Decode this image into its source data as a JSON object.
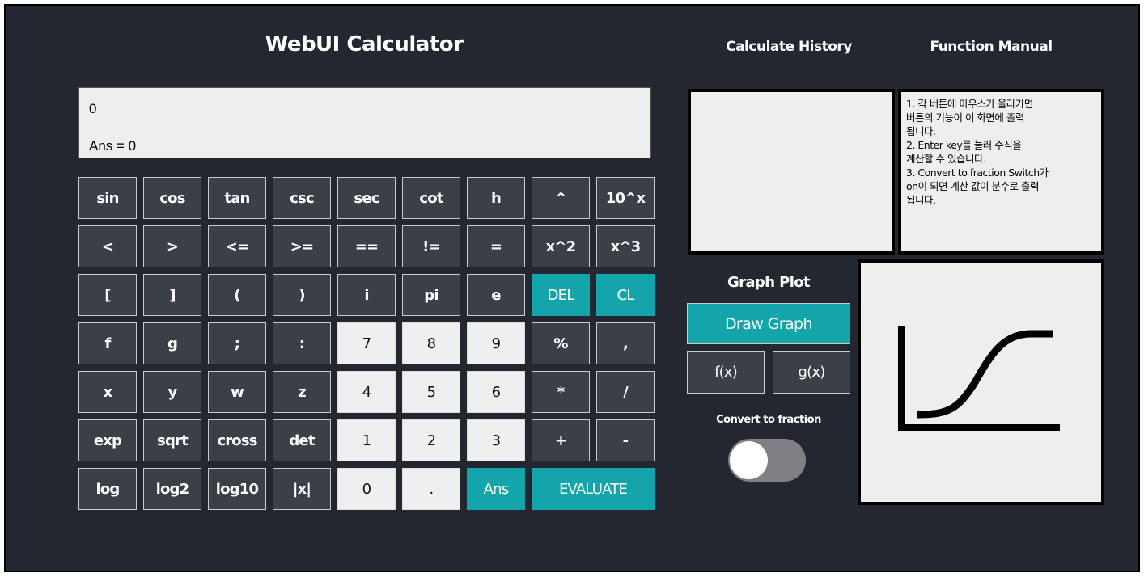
{
  "app": {
    "title": "WebUI Calculator",
    "history_title": "Calculate History",
    "manual_title": "Function Manual"
  },
  "display": {
    "expression": "0",
    "answer": "Ans = 0"
  },
  "keypad": {
    "rows": [
      [
        {
          "label": "sin",
          "style": "dark"
        },
        {
          "label": "cos",
          "style": "dark"
        },
        {
          "label": "tan",
          "style": "dark"
        },
        {
          "label": "csc",
          "style": "dark"
        },
        {
          "label": "sec",
          "style": "dark"
        },
        {
          "label": "cot",
          "style": "dark"
        },
        {
          "label": "h",
          "style": "dark"
        },
        {
          "label": "^",
          "style": "dark"
        },
        {
          "label": "10^x",
          "style": "dark"
        }
      ],
      [
        {
          "label": "<",
          "style": "dark"
        },
        {
          "label": ">",
          "style": "dark"
        },
        {
          "label": "<=",
          "style": "dark"
        },
        {
          "label": ">=",
          "style": "dark"
        },
        {
          "label": "==",
          "style": "dark"
        },
        {
          "label": "!=",
          "style": "dark"
        },
        {
          "label": "=",
          "style": "dark"
        },
        {
          "label": "x^2",
          "style": "dark"
        },
        {
          "label": "x^3",
          "style": "dark"
        }
      ],
      [
        {
          "label": "[",
          "style": "dark"
        },
        {
          "label": "]",
          "style": "dark"
        },
        {
          "label": "(",
          "style": "dark"
        },
        {
          "label": ")",
          "style": "dark"
        },
        {
          "label": "i",
          "style": "dark"
        },
        {
          "label": "pi",
          "style": "dark"
        },
        {
          "label": "e",
          "style": "dark"
        },
        {
          "label": "DEL",
          "style": "teal"
        },
        {
          "label": "CL",
          "style": "teal"
        }
      ],
      [
        {
          "label": "f",
          "style": "dark"
        },
        {
          "label": "g",
          "style": "dark"
        },
        {
          "label": ";",
          "style": "dark"
        },
        {
          "label": ":",
          "style": "dark"
        },
        {
          "label": "7",
          "style": "light"
        },
        {
          "label": "8",
          "style": "light"
        },
        {
          "label": "9",
          "style": "light"
        },
        {
          "label": "%",
          "style": "dark"
        },
        {
          "label": ",",
          "style": "dark"
        }
      ],
      [
        {
          "label": "x",
          "style": "dark"
        },
        {
          "label": "y",
          "style": "dark"
        },
        {
          "label": "w",
          "style": "dark"
        },
        {
          "label": "z",
          "style": "dark"
        },
        {
          "label": "4",
          "style": "light"
        },
        {
          "label": "5",
          "style": "light"
        },
        {
          "label": "6",
          "style": "light"
        },
        {
          "label": "*",
          "style": "dark"
        },
        {
          "label": "/",
          "style": "dark"
        }
      ],
      [
        {
          "label": "exp",
          "style": "dark"
        },
        {
          "label": "sqrt",
          "style": "dark"
        },
        {
          "label": "cross",
          "style": "dark"
        },
        {
          "label": "det",
          "style": "dark"
        },
        {
          "label": "1",
          "style": "light"
        },
        {
          "label": "2",
          "style": "light"
        },
        {
          "label": "3",
          "style": "light"
        },
        {
          "label": "+",
          "style": "dark"
        },
        {
          "label": "-",
          "style": "dark"
        }
      ],
      [
        {
          "label": "log",
          "style": "dark"
        },
        {
          "label": "log2",
          "style": "dark"
        },
        {
          "label": "log10",
          "style": "dark"
        },
        {
          "label": "|x|",
          "style": "dark"
        },
        {
          "label": "0",
          "style": "light"
        },
        {
          "label": ".",
          "style": "light"
        },
        {
          "label": "Ans",
          "style": "teal"
        },
        {
          "label": "EVALUATE",
          "style": "teal",
          "wide": true
        }
      ]
    ]
  },
  "manual": {
    "text": "1. 각 버튼에 마우스가 올라가면\n 버튼의 기능이 이 화면에 출력\n됩니다.\n2. Enter key를 눌러 수식을\n계산할 수 있습니다.\n3. Convert to fraction Switch가\n on이 되면 계산 값이 분수로 출력\n됩니다."
  },
  "graph": {
    "title": "Graph Plot",
    "draw_label": "Draw Graph",
    "f_label": "f(x)",
    "g_label": "g(x)",
    "icon": "sigmoid-graph-icon"
  },
  "fraction": {
    "label": "Convert to fraction",
    "enabled": false
  },
  "colors": {
    "background": "#232830",
    "button_dark": "#3a3f48",
    "button_light": "#efefef",
    "accent_teal": "#14a5ab",
    "panel": "#eeeeee"
  }
}
